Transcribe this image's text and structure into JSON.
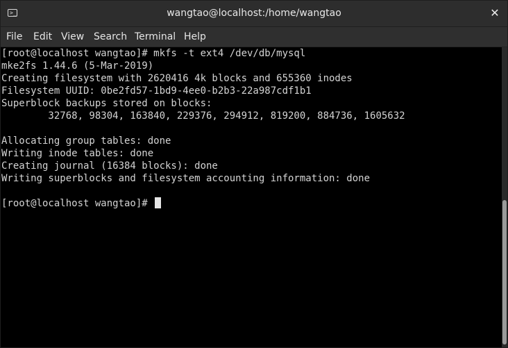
{
  "window": {
    "title": "wangtao@localhost:/home/wangtao",
    "icon": "terminal-icon",
    "icon_glyph": ">_",
    "close_glyph": "✕"
  },
  "menu": [
    "File",
    "Edit",
    "View",
    "Search",
    "Terminal",
    "Help"
  ],
  "terminal": {
    "lines": [
      "[root@localhost wangtao]# mkfs -t ext4 /dev/db/mysql",
      "mke2fs 1.44.6 (5-Mar-2019)",
      "Creating filesystem with 2620416 4k blocks and 655360 inodes",
      "Filesystem UUID: 0be2fd57-1bd9-4ee0-b2b3-22a987cdf1b1",
      "Superblock backups stored on blocks:",
      "        32768, 98304, 163840, 229376, 294912, 819200, 884736, 1605632",
      "",
      "Allocating group tables: done",
      "Writing inode tables: done",
      "Creating journal (16384 blocks): done",
      "Writing superblocks and filesystem accounting information: done",
      "",
      "[root@localhost wangtao]# "
    ],
    "colors": {
      "background": "#000000",
      "text": "#d4d4d4",
      "cursor": "#e6e6e6"
    }
  }
}
